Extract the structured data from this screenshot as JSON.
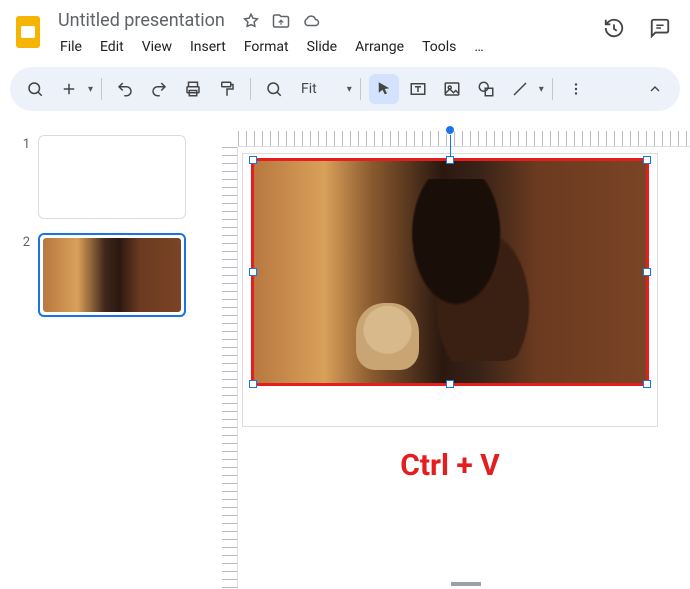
{
  "header": {
    "doc_title": "Untitled presentation",
    "menus": {
      "file": "File",
      "edit": "Edit",
      "view": "View",
      "insert": "Insert",
      "format": "Format",
      "slide": "Slide",
      "arrange": "Arrange",
      "tools": "Tools",
      "more": "…"
    }
  },
  "toolbar": {
    "zoom_label": "Fit"
  },
  "thumbnails": {
    "slide1_num": "1",
    "slide2_num": "2"
  },
  "annotation": {
    "shortcut_label": "Ctrl + V"
  }
}
